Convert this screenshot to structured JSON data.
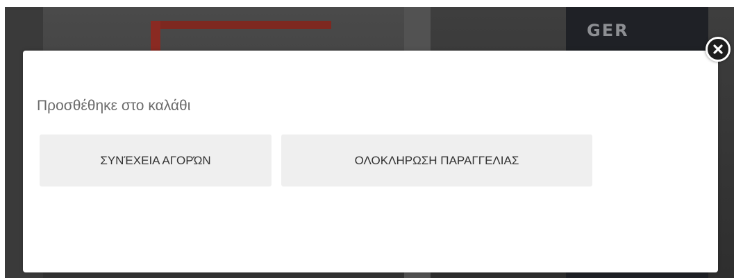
{
  "modal": {
    "title": "Προσθέθηκε στο καλάθι",
    "continue_label": "ΣΥΝΈΧΕΙΑ ΑΓΟΡΏΝ",
    "checkout_label": "ΟΛΟΚΛΗΡΩΣΗ ΠΑΡΑΓΓΕΛΙΑΣ",
    "close_icon": "close-icon"
  },
  "background": {
    "apron_logo": "GER"
  },
  "colors": {
    "overlay_bg": "#3a3a3a",
    "modal_bg": "#ffffff",
    "button_bg": "#efefef",
    "button_text": "#333333",
    "title_text": "#6b6b6b",
    "close_bg": "#1e1e1e"
  }
}
